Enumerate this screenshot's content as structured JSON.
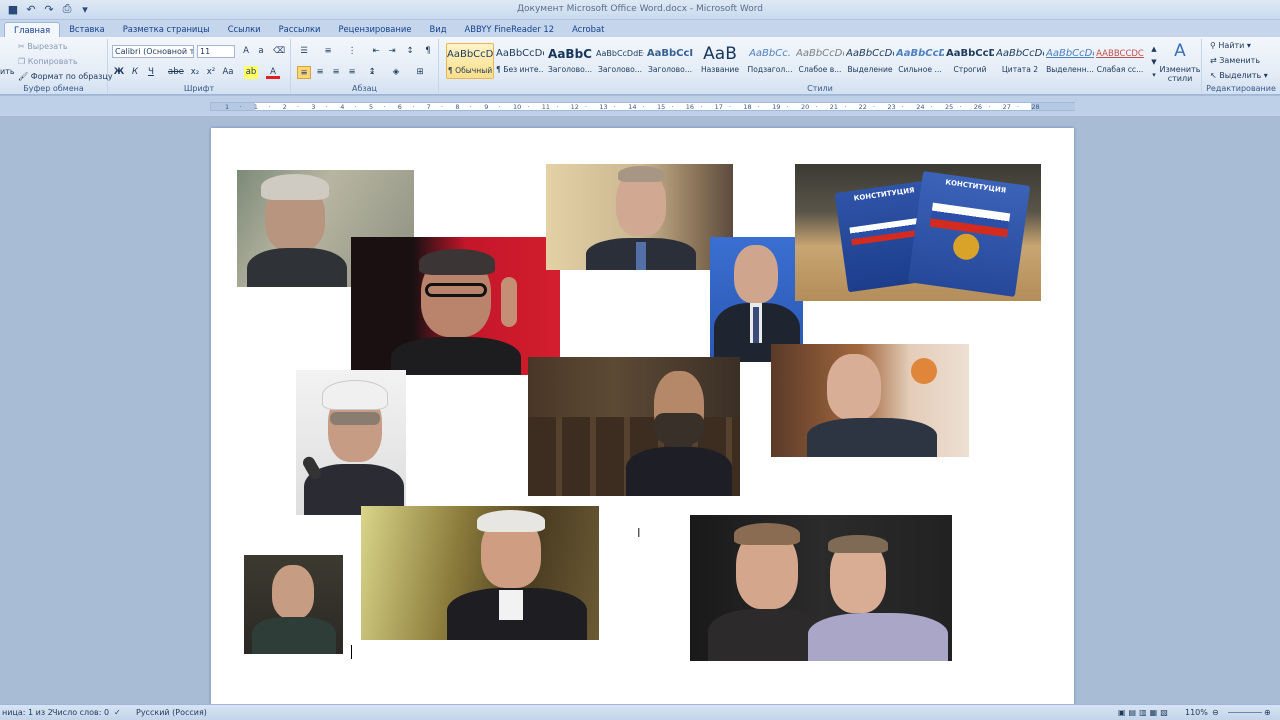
{
  "window": {
    "title": "Документ Microsoft Office Word.docx - Microsoft Word"
  },
  "tabs": [
    "Главная",
    "Вставка",
    "Разметка страницы",
    "Ссылки",
    "Рассылки",
    "Рецензирование",
    "Вид",
    "ABBYY FineReader 12",
    "Acrobat"
  ],
  "clipboard": {
    "paste_label": "ить",
    "cut": "Вырезать",
    "copy": "Копировать",
    "format_painter": "Формат по образцу",
    "group_label": "Буфер обмена"
  },
  "font": {
    "name": "Calibri (Основной те",
    "size": "11",
    "group_label": "Шрифт"
  },
  "paragraph": {
    "group_label": "Абзац"
  },
  "styles": {
    "group_label": "Стили",
    "items": [
      {
        "preview": "AaBbCcDc",
        "name": "¶ Обычный"
      },
      {
        "preview": "AaBbCcDc",
        "name": "¶ Без инте..."
      },
      {
        "preview": "AaBbC",
        "name": "Заголово..."
      },
      {
        "preview": "AaBbCcDdEe",
        "name": "Заголово..."
      },
      {
        "preview": "AaBbCcI",
        "name": "Заголово..."
      },
      {
        "preview": "AaB",
        "name": "Название"
      },
      {
        "preview": "AaBbCc.",
        "name": "Подзагол..."
      },
      {
        "preview": "AaBbCcDc",
        "name": "Слабое в..."
      },
      {
        "preview": "AaBbCcDc",
        "name": "Выделение"
      },
      {
        "preview": "AaBbCcDc",
        "name": "Сильное ..."
      },
      {
        "preview": "AaBbCcDc",
        "name": "Строгий"
      },
      {
        "preview": "AaBbCcDc",
        "name": "Цитата 2"
      },
      {
        "preview": "AaBbCcDc",
        "name": "Выделенн..."
      },
      {
        "preview": "AABBCCDC",
        "name": "Слабая сс..."
      }
    ],
    "change_styles": "Изменить стили"
  },
  "editing": {
    "group_label": "Редактирование",
    "find": "Найти",
    "replace": "Заменить",
    "select": "Выделить"
  },
  "ruler_ticks": [
    "1",
    "·",
    "1",
    "·",
    "2",
    "·",
    "3",
    "·",
    "4",
    "·",
    "5",
    "·",
    "6",
    "·",
    "7",
    "·",
    "8",
    "·",
    "9",
    "·",
    "10",
    "·",
    "11",
    "·",
    "12",
    "·",
    "13",
    "·",
    "14",
    "·",
    "15",
    "·",
    "16",
    "·",
    "17",
    "·",
    "18",
    "·",
    "19",
    "·",
    "20",
    "·",
    "21",
    "·",
    "22",
    "·",
    "23",
    "·",
    "24",
    "·",
    "25",
    "·",
    "26",
    "·",
    "27",
    "·",
    "28"
  ],
  "book_text": "КОНСТИТУЦИЯ",
  "status": {
    "page": "ница: 1 из 2",
    "words": "Число слов: 0",
    "language": "Русский (Россия)",
    "zoom": "110%"
  },
  "colors": {
    "accent": "#1e395b",
    "ribbon": "#e2ebf6",
    "workspace": "#a9bcd6"
  }
}
